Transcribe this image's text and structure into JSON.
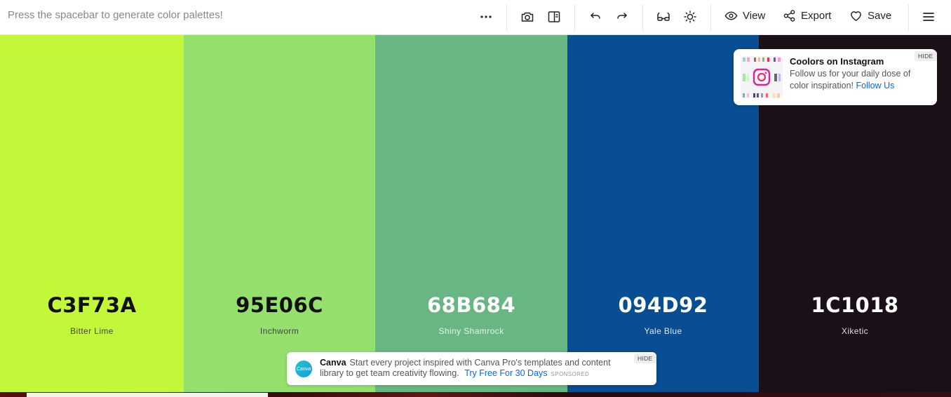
{
  "toolbar": {
    "hint": "Press the spacebar to generate color palettes!",
    "view_label": "View",
    "export_label": "Export",
    "save_label": "Save"
  },
  "palette": [
    {
      "hex": "C3F73A",
      "name": "Bitter Lime",
      "bg": "#C3F73A",
      "text_color": "#111111",
      "name_color": "#444444"
    },
    {
      "hex": "95E06C",
      "name": "Inchworm",
      "bg": "#95E06C",
      "text_color": "#111111",
      "name_color": "#444444"
    },
    {
      "hex": "68B684",
      "name": "Shiny Shamrock",
      "bg": "#68B684",
      "text_color": "#ffffff",
      "name_color": "#e8f5ec"
    },
    {
      "hex": "094D92",
      "name": "Yale Blue",
      "bg": "#094D92",
      "text_color": "#ffffff",
      "name_color": "#dce7f3"
    },
    {
      "hex": "1C1018",
      "name": "Xiketic",
      "bg": "#1C1018",
      "text_color": "#ffffff",
      "name_color": "#dddddd"
    }
  ],
  "instagram_card": {
    "title": "Coolors on Instagram",
    "body": "Follow us for your daily dose of color inspiration!",
    "link": "Follow Us",
    "hide": "HIDE"
  },
  "canva_ad": {
    "logo_text": "Canva",
    "brand": "Canva",
    "body": "Start every project inspired with Canva Pro's templates and content library to get team creativity flowing.",
    "cta": "Try Free For 30 Days",
    "sponsored": "SPONSORED",
    "hide": "HIDE"
  },
  "icons": {
    "more": "more-icon",
    "camera": "camera-icon",
    "panel": "panel-icon",
    "undo": "undo-icon",
    "redo": "redo-icon",
    "glasses": "glasses-icon",
    "sun": "sun-icon",
    "eye": "eye-icon",
    "share": "share-icon",
    "heart": "heart-icon",
    "menu": "menu-icon"
  }
}
